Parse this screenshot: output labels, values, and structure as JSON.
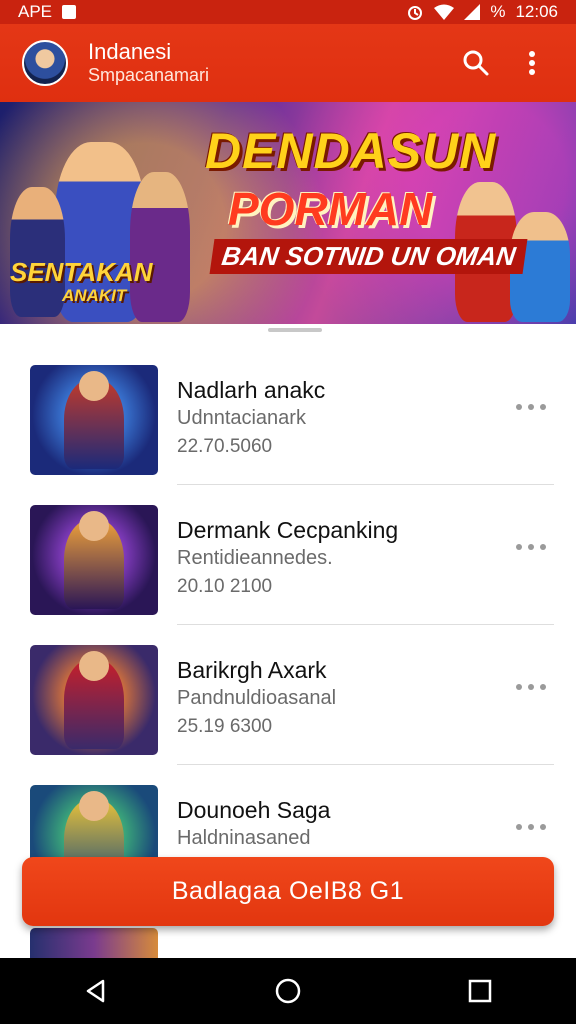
{
  "status_bar": {
    "left_text": "APE",
    "time": "12:06",
    "battery_label": "%"
  },
  "app_bar": {
    "title": "Indanesi",
    "subtitle": "Smpacanamari",
    "icons": [
      "search-icon",
      "more-vert-icon"
    ]
  },
  "banner": {
    "headline_1": "DENDASUN",
    "headline_2": "PORMAN",
    "subline": "BAN SOTNID UN OMAN",
    "logo_line_1": "SENTAKAN",
    "logo_line_2": "ANAKIT"
  },
  "games": [
    {
      "name": "Nadlarh anakc",
      "developer": "Udnntacianark",
      "meta": "22.70.5060",
      "palette": [
        "#1b2a7a",
        "#3c7bd9",
        "#c23a2a"
      ]
    },
    {
      "name": "Dermank Cecpanking",
      "developer": "Rentidieannedes.",
      "meta": "20.10 2100",
      "palette": [
        "#2a1656",
        "#8a3fc7",
        "#f0a23a"
      ]
    },
    {
      "name": "Barikrgh Axark",
      "developer": "Pandnuldioasanal",
      "meta": "25.19 6300",
      "palette": [
        "#3a2a6a",
        "#d9743a",
        "#c71f2a"
      ]
    },
    {
      "name": "Dounoeh Saga",
      "developer": "Haldninasaned",
      "meta": "",
      "palette": [
        "#1a4a7a",
        "#3fb27a",
        "#e8c23a"
      ]
    }
  ],
  "cta": {
    "label": "Badlagaa OeIB8 G1"
  },
  "nav_bar": {
    "icons": [
      "back-icon",
      "home-icon",
      "recents-icon"
    ]
  },
  "colors": {
    "primary": "#e43716",
    "cta": "#f0471b",
    "status_bar": "#c9230f"
  }
}
